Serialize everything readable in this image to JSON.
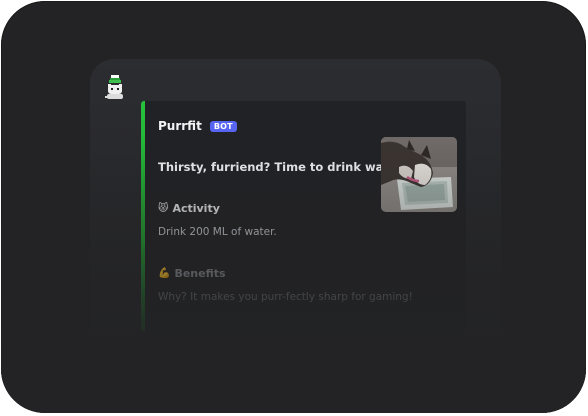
{
  "message": {
    "author": "Purrfit",
    "badge": "BOT",
    "accent_color": "#27c23b",
    "badge_color": "#5865f2"
  },
  "embed": {
    "title": "Thirsty, furriend? Time to drink water!",
    "thumbnail": "cat-drinking-water-photo",
    "fields": [
      {
        "emoji": "😾",
        "icon": "cat-face-icon",
        "name": "Activity",
        "value": "Drink 200 ML of water."
      },
      {
        "emoji": "💪",
        "icon": "flexed-bicep-icon",
        "name": "Benefits",
        "value": "Why? It makes you purr-fectly sharp for gaming!"
      }
    ]
  }
}
